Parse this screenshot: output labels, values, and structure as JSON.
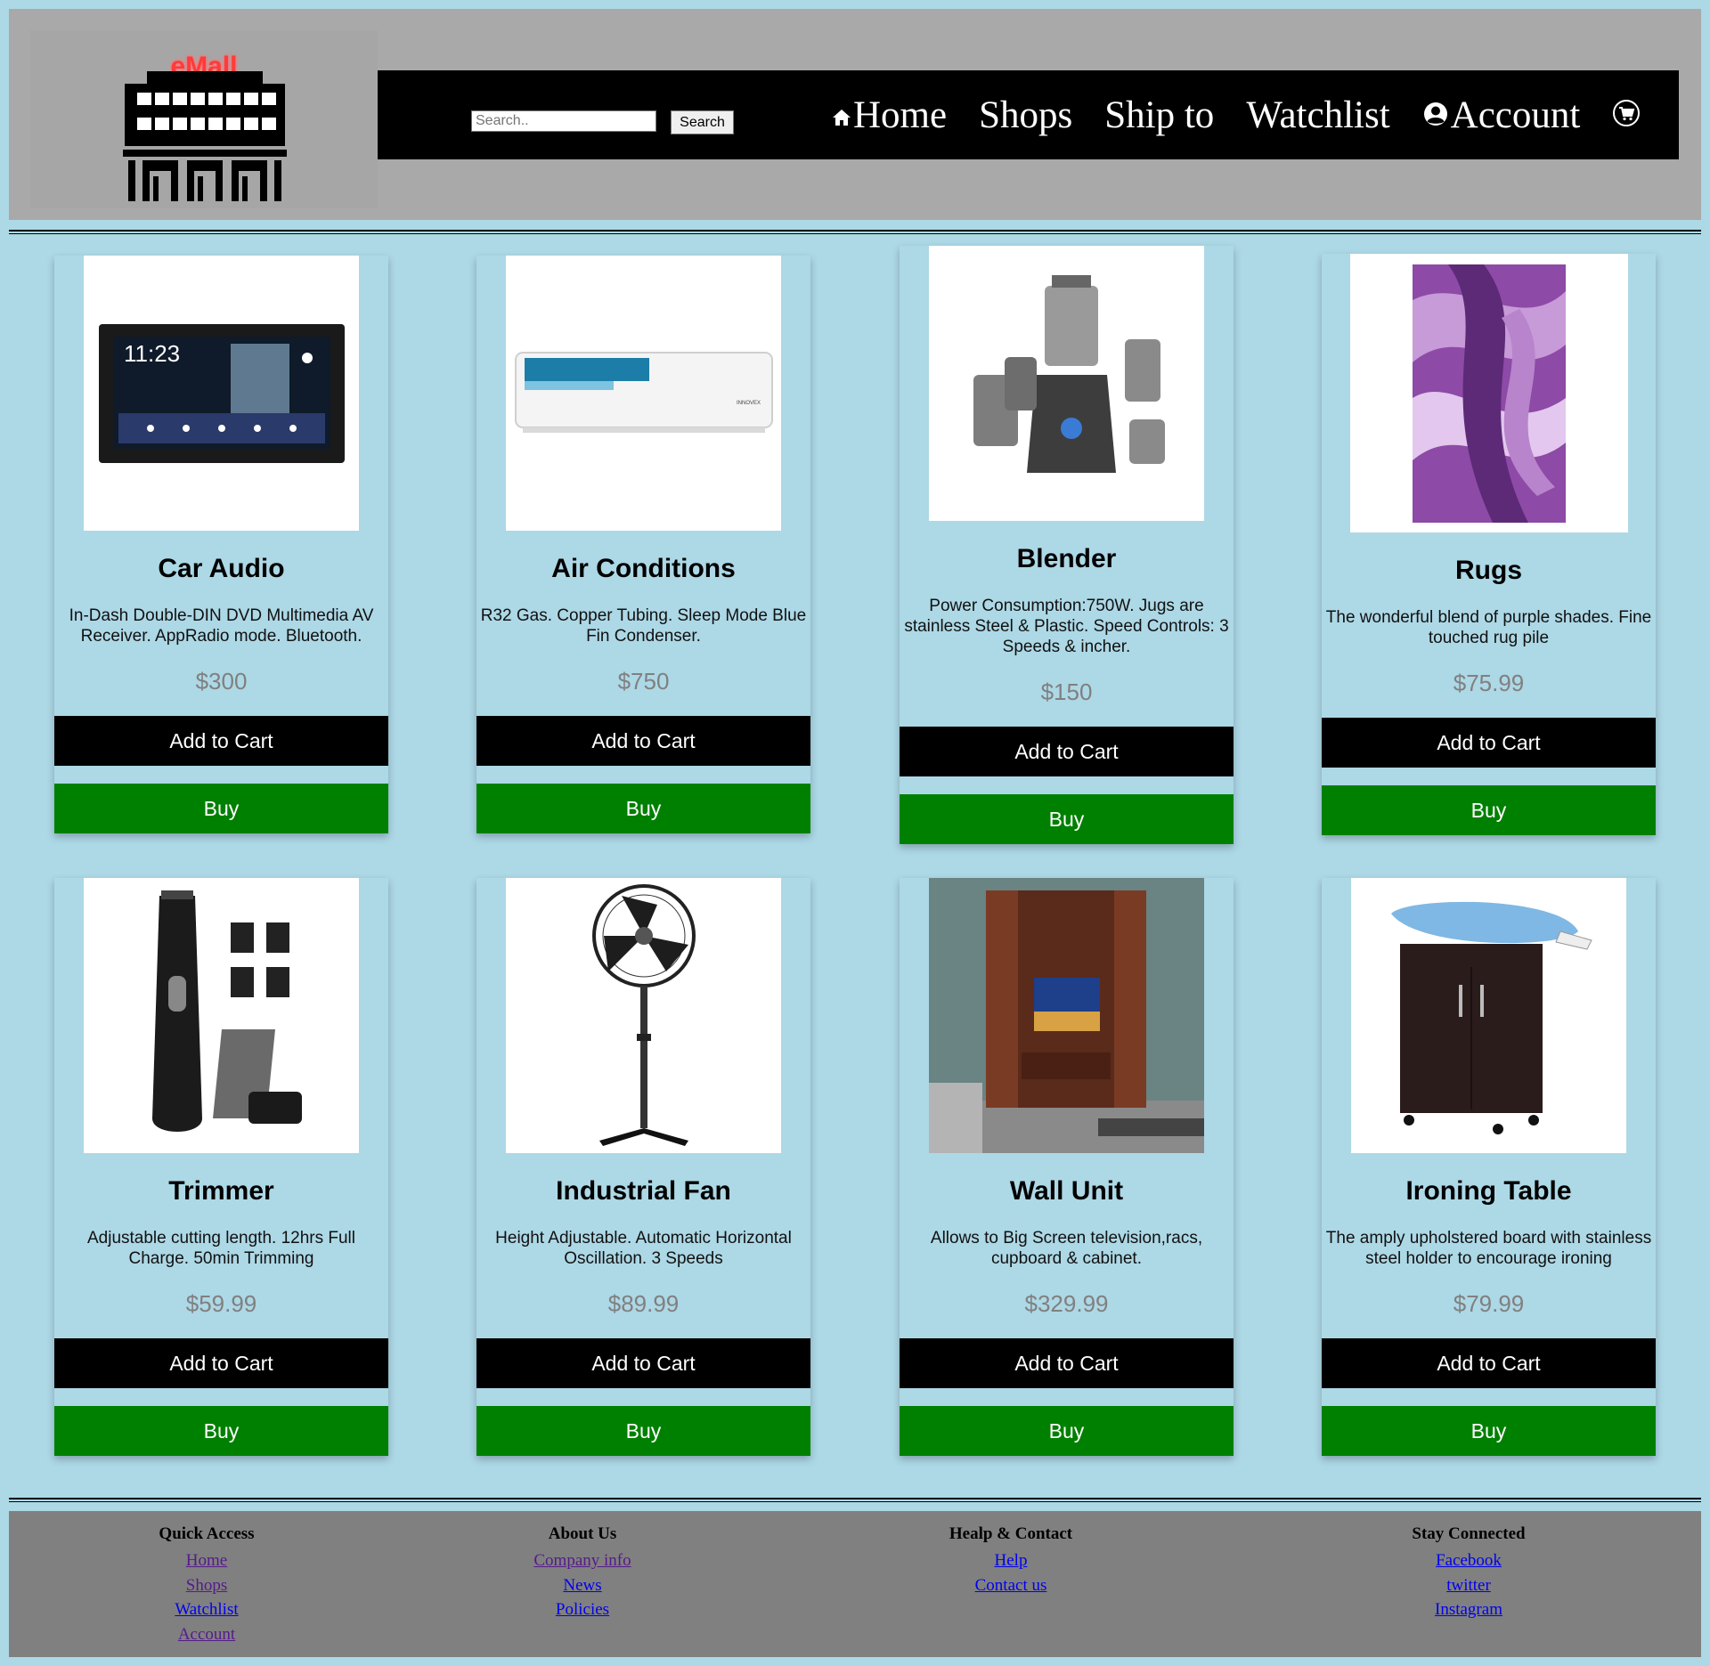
{
  "header": {
    "logo_text": "eMall",
    "search": {
      "placeholder": "Search..",
      "button_label": "Search"
    },
    "nav": {
      "home": "Home",
      "shops": "Shops",
      "ship_to": "Ship to",
      "watchlist": "Watchlist",
      "account": "Account"
    }
  },
  "products": [
    {
      "name": "Car Audio",
      "description": "In-Dash Double-DIN DVD Multimedia AV Receiver. AppRadio mode. Bluetooth.",
      "price": "$300",
      "add_label": "Add to Cart",
      "buy_label": "Buy"
    },
    {
      "name": "Air Conditions",
      "description": "R32 Gas. Copper Tubing. Sleep Mode Blue Fin Condenser.",
      "price": "$750",
      "add_label": "Add to Cart",
      "buy_label": "Buy"
    },
    {
      "name": "Blender",
      "description": "Power Consumption:750W. Jugs are stainless Steel & Plastic. Speed Controls: 3 Speeds & incher.",
      "price": "$150",
      "add_label": "Add to Cart",
      "buy_label": "Buy"
    },
    {
      "name": "Rugs",
      "description": "The wonderful blend of purple shades. Fine touched rug pile",
      "price": "$75.99",
      "add_label": "Add to Cart",
      "buy_label": "Buy"
    },
    {
      "name": "Trimmer",
      "description": "Adjustable cutting length. 12hrs Full Charge. 50min Trimming",
      "price": "$59.99",
      "add_label": "Add to Cart",
      "buy_label": "Buy"
    },
    {
      "name": "Industrial Fan",
      "description": "Height Adjustable. Automatic Horizontal Oscillation. 3 Speeds",
      "price": "$89.99",
      "add_label": "Add to Cart",
      "buy_label": "Buy"
    },
    {
      "name": "Wall Unit",
      "description": "Allows to Big Screen television,racs, cupboard & cabinet.",
      "price": "$329.99",
      "add_label": "Add to Cart",
      "buy_label": "Buy"
    },
    {
      "name": "Ironing Table",
      "description": "The amply upholstered board with stainless steel holder to encourage ironing",
      "price": "$79.99",
      "add_label": "Add to Cart",
      "buy_label": "Buy"
    }
  ],
  "footer": {
    "quick_access": {
      "title": "Quick Access",
      "links": [
        "Home",
        "Shops",
        "Watchlist",
        "Account"
      ]
    },
    "about_us": {
      "title": "About Us",
      "links": [
        "Company info",
        "News",
        "Policies"
      ]
    },
    "help_contact": {
      "title": "Healp & Contact",
      "links": [
        "Help",
        "Contact us"
      ]
    },
    "stay_connected": {
      "title": "Stay Connected",
      "links": [
        "Facebook",
        "twitter",
        "Instagram"
      ]
    }
  },
  "colors": {
    "page_bg": "#add8e6",
    "header_bg": "#a9a9a9",
    "navbar_bg": "#000000",
    "add_to_cart_bg": "#000000",
    "buy_bg": "#008000",
    "price_text": "#808080",
    "footer_bg": "#808080",
    "logo_text": "#ff3b3b"
  },
  "icons": {
    "home": "home-icon",
    "account": "user-circle-icon",
    "cart": "shopping-cart-icon"
  }
}
